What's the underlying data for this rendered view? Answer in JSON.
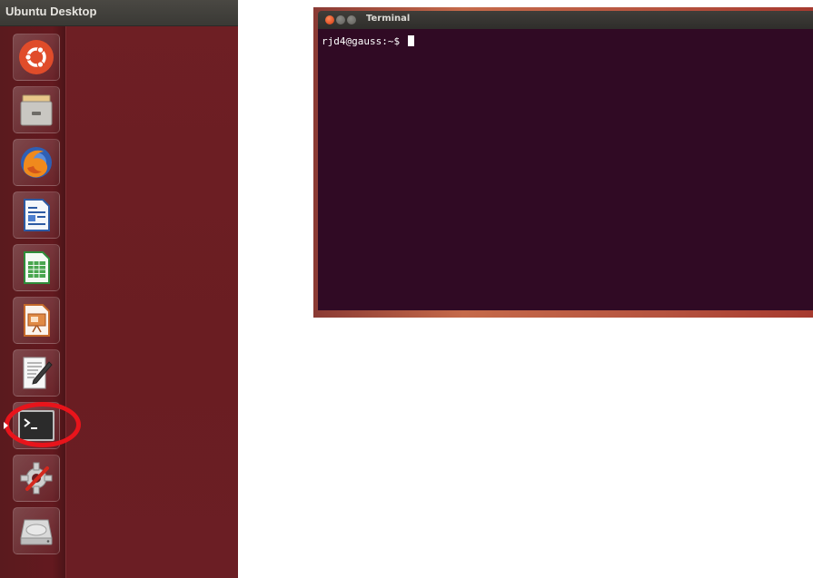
{
  "desktop": {
    "title": "Ubuntu Desktop",
    "background_color": "#6e1f24"
  },
  "launcher": {
    "items": [
      {
        "name": "dash-home",
        "icon": "ubuntu-logo-icon"
      },
      {
        "name": "files",
        "icon": "file-cabinet-icon"
      },
      {
        "name": "firefox",
        "icon": "firefox-icon"
      },
      {
        "name": "writer",
        "icon": "document-icon"
      },
      {
        "name": "calc",
        "icon": "spreadsheet-icon"
      },
      {
        "name": "impress",
        "icon": "presentation-icon"
      },
      {
        "name": "text-editor",
        "icon": "text-editor-icon"
      },
      {
        "name": "terminal",
        "icon": "terminal-icon",
        "highlighted": true
      },
      {
        "name": "system-settings",
        "icon": "settings-icon"
      },
      {
        "name": "disk",
        "icon": "hard-disk-icon"
      }
    ],
    "highlight_color": "#e8141b"
  },
  "terminal": {
    "title": "Terminal",
    "prompt": "rjd4@gauss:~$ ",
    "background_color": "#300a24"
  }
}
